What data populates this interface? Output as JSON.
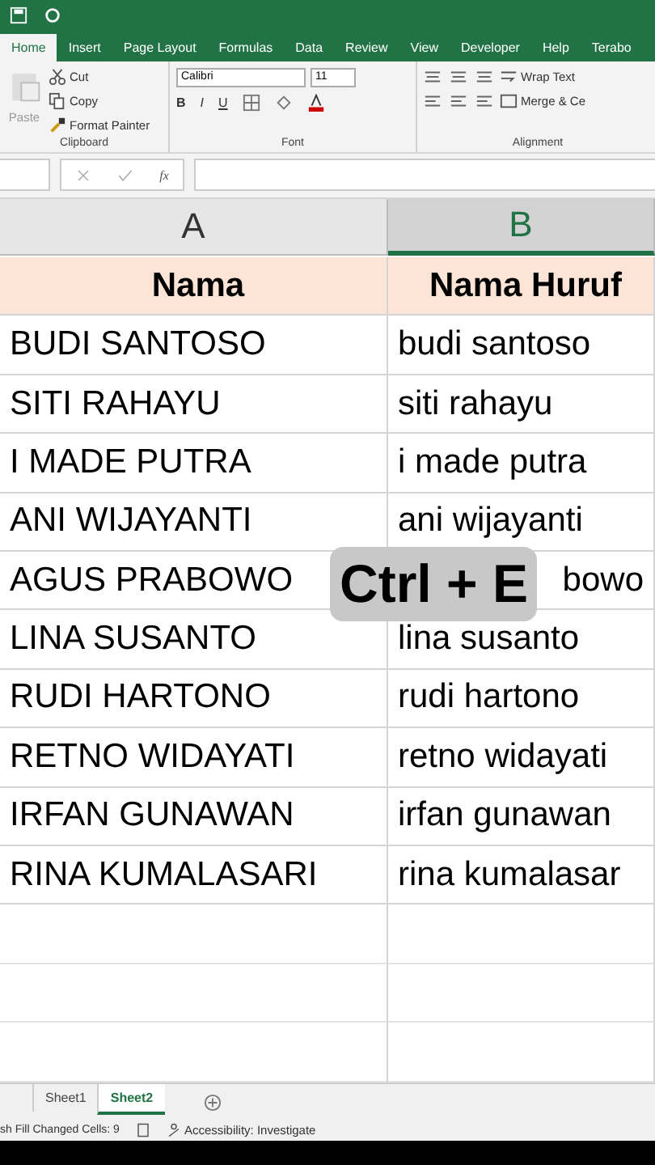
{
  "menu_tabs": [
    {
      "label": "Home",
      "selected": true
    },
    {
      "label": "Insert",
      "selected": false
    },
    {
      "label": "Page Layout",
      "selected": false
    },
    {
      "label": "Formulas",
      "selected": false
    },
    {
      "label": "Data",
      "selected": false
    },
    {
      "label": "Review",
      "selected": false
    },
    {
      "label": "View",
      "selected": false
    },
    {
      "label": "Developer",
      "selected": false
    },
    {
      "label": "Help",
      "selected": false
    },
    {
      "label": "Terabo",
      "selected": false
    }
  ],
  "clipboard": {
    "paste": "Paste",
    "cut": "Cut",
    "copy": "Copy",
    "format_painter": "Format Painter",
    "label": "Clipboard"
  },
  "font": {
    "name": "Calibri",
    "size": "11",
    "bold": "B",
    "italic": "I",
    "underline": "U",
    "label": "Font"
  },
  "alignment": {
    "wrap": "Wrap Text",
    "merge": "Merge & Ce",
    "label": "Alignment"
  },
  "formula_bar": {
    "fx": "fx"
  },
  "columns": [
    {
      "label": "A",
      "selected": false
    },
    {
      "label": "B",
      "selected": true
    }
  ],
  "header_row": [
    "Nama",
    "Nama Huruf"
  ],
  "rows": [
    [
      "BUDI SANTOSO",
      "budi santoso"
    ],
    [
      "SITI RAHAYU",
      "siti rahayu"
    ],
    [
      "I MADE PUTRA",
      "i made putra"
    ],
    [
      "ANI WIJAYANTI",
      "ani wijayanti"
    ],
    [
      "AGUS PRABOWO",
      {
        "text": "bowo",
        "covered": true
      }
    ],
    [
      "LINA SUSANTO",
      "lina susanto"
    ],
    [
      "RUDI HARTONO",
      "rudi hartono"
    ],
    [
      "RETNO WIDAYATI",
      "retno widayati"
    ],
    [
      "IRFAN GUNAWAN",
      "irfan gunawan"
    ],
    [
      "RINA KUMALASARI",
      "rina kumalasar"
    ]
  ],
  "overlay": {
    "text": "Ctrl + E"
  },
  "sheets": [
    {
      "label": "Sheet1",
      "selected": false
    },
    {
      "label": "Sheet2",
      "selected": true
    }
  ],
  "status_bar": {
    "message": "sh Fill Changed Cells: 9",
    "accessibility": "Accessibility: Investigate"
  }
}
